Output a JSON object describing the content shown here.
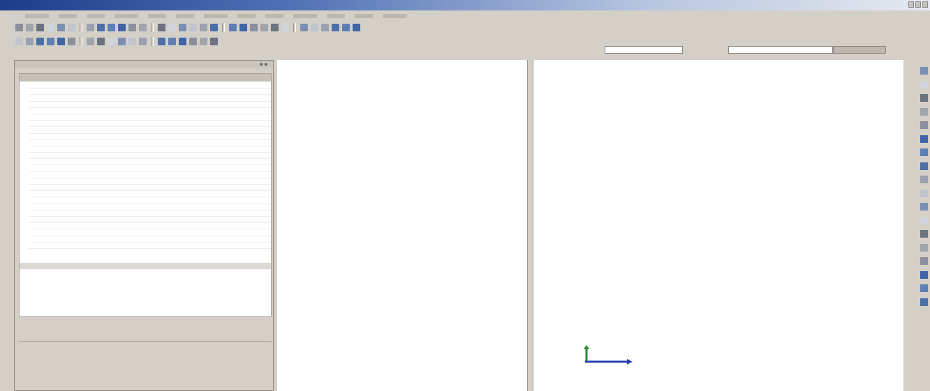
{
  "window": {
    "title": "",
    "controls": [
      "minimize-icon",
      "maximize-icon",
      "close-icon"
    ]
  },
  "menubar": {
    "items": [
      "",
      "",
      "",
      "",
      "",
      "",
      "",
      "",
      "",
      "",
      "",
      "",
      ""
    ]
  },
  "toolbar1": {
    "buttons": [
      "new-icon",
      "open-icon",
      "save-icon",
      "print-icon",
      "undo-icon",
      "redo-icon",
      "cut-icon",
      "copy-icon",
      "paste-icon",
      "delete-icon",
      "select-icon",
      "move-icon",
      "rotate-icon",
      "zoom-icon",
      "pan-icon",
      "fit-icon",
      "render-icon",
      "mesh-icon",
      "line-icon",
      "arc-icon",
      "circle-icon",
      "rect-icon",
      "dimension-icon",
      "constraint-icon",
      "grid-icon",
      "snap-icon",
      "layer-icon",
      "color-icon",
      "light-icon",
      "camera-icon"
    ]
  },
  "toolbar2": {
    "buttons": [
      "view-front-icon",
      "view-back-icon",
      "view-top-icon",
      "view-bottom-icon",
      "view-left-icon",
      "view-right-icon",
      "iso-icon",
      "wireframe-icon",
      "shaded-icon",
      "hidden-line-icon",
      "section-icon",
      "measure-icon",
      "point-icon",
      "axis-icon",
      "plane-icon",
      "csys-icon",
      "explode-icon",
      "analysis-icon"
    ],
    "combo1": {
      "value": ""
    },
    "combo2": {
      "value": ""
    }
  },
  "panel": {
    "title": "",
    "tree_header": "",
    "rows": [
      {
        "key": "",
        "value": ""
      },
      {
        "key": "",
        "value": ""
      },
      {
        "key": "",
        "value": ""
      },
      {
        "key": "",
        "value": ""
      },
      {
        "key": "",
        "value": ""
      },
      {
        "key": "",
        "value": ""
      },
      {
        "key": "",
        "value": ""
      },
      {
        "key": "",
        "value": ""
      },
      {
        "key": "",
        "value": ""
      },
      {
        "key": "",
        "value": ""
      },
      {
        "key": "",
        "value": ""
      },
      {
        "key": "",
        "value": ""
      },
      {
        "key": "",
        "value": ""
      },
      {
        "key": "",
        "value": ""
      },
      {
        "key": "",
        "value": ""
      },
      {
        "key": "",
        "value": ""
      },
      {
        "key": "",
        "value": ""
      },
      {
        "key": "",
        "value": ""
      },
      {
        "key": "",
        "value": ""
      },
      {
        "key": "",
        "value": ""
      },
      {
        "key": "",
        "value": ""
      },
      {
        "key": "",
        "value": ""
      },
      {
        "key": "",
        "value": ""
      },
      {
        "key": "",
        "value": ""
      },
      {
        "key": "",
        "value": ""
      },
      {
        "key": "",
        "value": ""
      }
    ],
    "tree_footer": "",
    "tabs": [
      "",
      "",
      "",
      "",
      "",
      ""
    ]
  },
  "viewport": {
    "triad_label_x": "",
    "triad_label_y": ""
  },
  "right_toolbar": {
    "buttons": [
      "sketch-icon",
      "extrude-icon",
      "revolve-icon",
      "sweep-icon",
      "loft-icon",
      "hole-icon",
      "fillet-icon",
      "chamfer-icon",
      "shell-icon",
      "pattern-icon",
      "mirror-icon",
      "rib-icon",
      "draft-icon",
      "boolean-icon",
      "split-icon",
      "thicken-icon",
      "surface-icon",
      "repair-icon"
    ]
  },
  "colors": {
    "titlebar_start": "#1e3c8a",
    "face": "#d4d0c8",
    "axis_x": "#2a3fb0",
    "axis_y": "#2a8a2a"
  }
}
